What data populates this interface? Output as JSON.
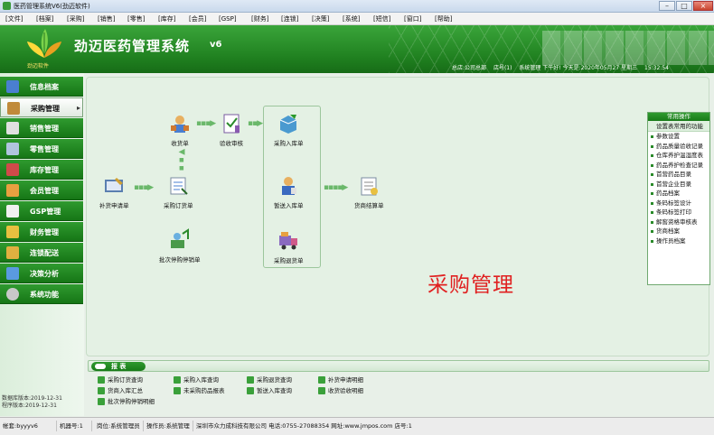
{
  "window": {
    "title": "医药管理系统V6(劲迈软件)"
  },
  "menu": [
    "[文件]",
    "[档案]",
    "[采购]",
    "[销售]",
    "[零售]",
    "[库存]",
    "[会员]",
    "[GSP]",
    "[财务]",
    "[连锁]",
    "[决策]",
    "[系统]",
    "[短信]",
    "[窗口]",
    "[帮助]"
  ],
  "header": {
    "logo_text": "劲迈软件",
    "title": "劲迈医药管理系统",
    "version": "v6",
    "status": {
      "company": "总店:公司总部",
      "store": "店号(1)",
      "greeting": "系统管理 下午好! 今天是:2020年05月27 星期三",
      "time": "15:32:54"
    }
  },
  "nav": {
    "items": [
      {
        "label": "信息档案",
        "icon": "info-archive-icon"
      },
      {
        "label": "采购管理",
        "icon": "purchase-icon",
        "active": true
      },
      {
        "label": "销售管理",
        "icon": "sales-icon"
      },
      {
        "label": "零售管理",
        "icon": "retail-icon"
      },
      {
        "label": "库存管理",
        "icon": "inventory-icon"
      },
      {
        "label": "会员管理",
        "icon": "member-icon"
      },
      {
        "label": "GSP管理",
        "icon": "gsp-icon"
      },
      {
        "label": "财务管理",
        "icon": "finance-icon"
      },
      {
        "label": "连锁配送",
        "icon": "delivery-icon"
      },
      {
        "label": "决策分析",
        "icon": "analysis-icon"
      },
      {
        "label": "系统功能",
        "icon": "system-gear-icon"
      }
    ],
    "footer": [
      "数据库版本:2019-12-31",
      "程序版本:2019-12-31"
    ]
  },
  "flow": {
    "nodes": {
      "replenish": "补货申请单",
      "order": "采购订货单",
      "receive": "收货单",
      "check": "验收审核",
      "inbound": "采购入库单",
      "quick_inbound": "暂送入库单",
      "return": "采购退货单",
      "settle": "货商结算单",
      "batch_return": "批次停购停销单"
    },
    "title": "采购管理"
  },
  "quick_panel": {
    "title": "常用操作",
    "subtitle": "设置表常用的功能",
    "items": [
      "参数设置",
      "药品质量验收记录",
      "仓库养护温湿度表",
      "药品养护检查记录",
      "首营药品目录",
      "首营企业目录",
      "药品档案",
      "条码标签设计",
      "条码标签打印",
      "解窖资格审核表",
      "货商档案",
      "操作员档案"
    ]
  },
  "reports": {
    "title": "报 表",
    "links": [
      [
        "采购订货查询",
        "采购入库查询",
        "采购退货查询",
        "补货申请明细"
      ],
      [
        "货商入库汇总",
        "未采购药品报表",
        "暂送入库查询",
        "收货验收明细"
      ],
      [
        "批次停购停销明细"
      ]
    ]
  },
  "statusbar": {
    "account": "帐套:byyyv6",
    "machine": "机器号:1",
    "position": "岗位:系统管理员",
    "operator": "操作员:系统管理",
    "company": "深圳市众力成科技有限公司 电话:0755-27088354 网址:www.jmpos.com 店号:1"
  },
  "colors": {
    "brand_green": "#1f7f1f",
    "accent_red": "#e02020",
    "header_green": "#3aa53a"
  }
}
